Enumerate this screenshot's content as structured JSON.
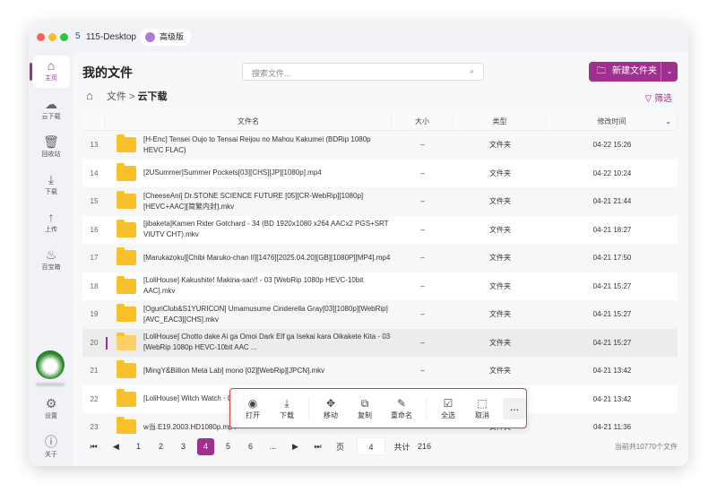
{
  "window": {
    "app_name": "115-Desktop",
    "plan_badge": "高级版"
  },
  "sidebar": {
    "items": [
      {
        "label": "主页",
        "icon": "home-icon"
      },
      {
        "label": "云下载",
        "icon": "cloud-download-icon"
      },
      {
        "label": "回收站",
        "icon": "trash-icon"
      },
      {
        "label": "下载",
        "icon": "download-icon"
      },
      {
        "label": "上传",
        "icon": "upload-icon"
      },
      {
        "label": "百宝箱",
        "icon": "flame-icon"
      }
    ],
    "settings": "设置",
    "about": "关于"
  },
  "header": {
    "title": "我的文件",
    "search_placeholder": "搜索文件...",
    "new_folder": "新建文件夹",
    "filter": "筛选"
  },
  "breadcrumb": {
    "root": "文件",
    "sep": ">",
    "current": "云下载"
  },
  "table": {
    "columns": [
      "文件名",
      "大小",
      "类型",
      "修改时间"
    ],
    "rows": [
      {
        "n": "13",
        "name": "[H-Enc] Tensei Oujo to Tensai Reijou no Mahou Kakumei (BDRip 1080p HEVC FLAC)",
        "size": "–",
        "type": "文件夹",
        "time": "04-22 15:26"
      },
      {
        "n": "14",
        "name": "[2USummer]Summer Pockets[03][CHS][JP][1080p].mp4",
        "size": "–",
        "type": "文件夹",
        "time": "04-22 10:24"
      },
      {
        "n": "15",
        "name": "[CheeseAni] Dr.STONE SCIENCE FUTURE [05][CR-WebRip][1080p][HEVC+AAC][简繁内封].mkv",
        "size": "–",
        "type": "文件夹",
        "time": "04-21 21:44"
      },
      {
        "n": "16",
        "name": "[jibaketa]Kamen Rider Gotchard - 34 (BD 1920x1080 x264 AACx2 PGS+SRT VIUTV CHT).mkv",
        "size": "–",
        "type": "文件夹",
        "time": "04-21 18:27"
      },
      {
        "n": "17",
        "name": "[Marukazoku][Chibi Maruko-chan II][1476][2025.04.20][GB][1080P][MP4].mp4",
        "size": "–",
        "type": "文件夹",
        "time": "04-21 17:50"
      },
      {
        "n": "18",
        "name": "[LoliHouse] Kakushite! Makina-san!! - 03 [WebRip 1080p HEVC-10bit AAC].mkv",
        "size": "–",
        "type": "文件夹",
        "time": "04-21 15:27"
      },
      {
        "n": "19",
        "name": "[OguriClub&S1YURICON] Umamusume Cinderella Gray[03][1080p][WebRip][AVC_EAC3][CHS].mkv",
        "size": "–",
        "type": "文件夹",
        "time": "04-21 15:27"
      },
      {
        "n": "20",
        "name": "[LoliHouse] Chotto dake Ai ga Omoi Dark Elf ga Isekai kara Oikakete Kita - 03 [WebRip 1080p HEVC-10bit AAC ...",
        "size": "–",
        "type": "文件夹",
        "time": "04-21 15:27"
      },
      {
        "n": "21",
        "name": "[MingY&Billion Meta Lab] mono [02][WebRip][JPCN].mkv",
        "size": "–",
        "type": "文件夹",
        "time": "04-21 13:42"
      },
      {
        "n": "22",
        "name": "[LoliHouse] Witch Watch - 03 [WebRip 1080p HEVC-10bit AAC SRTx2].mkv",
        "size": "–",
        "type": "文件夹",
        "time": "04-21 13:42"
      },
      {
        "n": "23",
        "name": "w当.E19.2003.HD1080p.mp4",
        "size": "–",
        "type": "文件夹",
        "time": "04-21 11:36"
      }
    ]
  },
  "pagination": {
    "pages": [
      "1",
      "2",
      "3",
      "4",
      "5",
      "6",
      "..."
    ],
    "current": "4",
    "page_label": "页",
    "page_input": "4",
    "total_label": "共计",
    "total": "216",
    "summary": "当前共10770个文件"
  },
  "toolbar": {
    "open": "打开",
    "download": "下载",
    "move": "移动",
    "copy": "复制",
    "rename": "重命名",
    "select_all": "全选",
    "cancel": "取消",
    "more": "..."
  },
  "colors": {
    "accent": "#a0308f",
    "folder": "#f8c12a",
    "highlight_border": "#e53935"
  }
}
